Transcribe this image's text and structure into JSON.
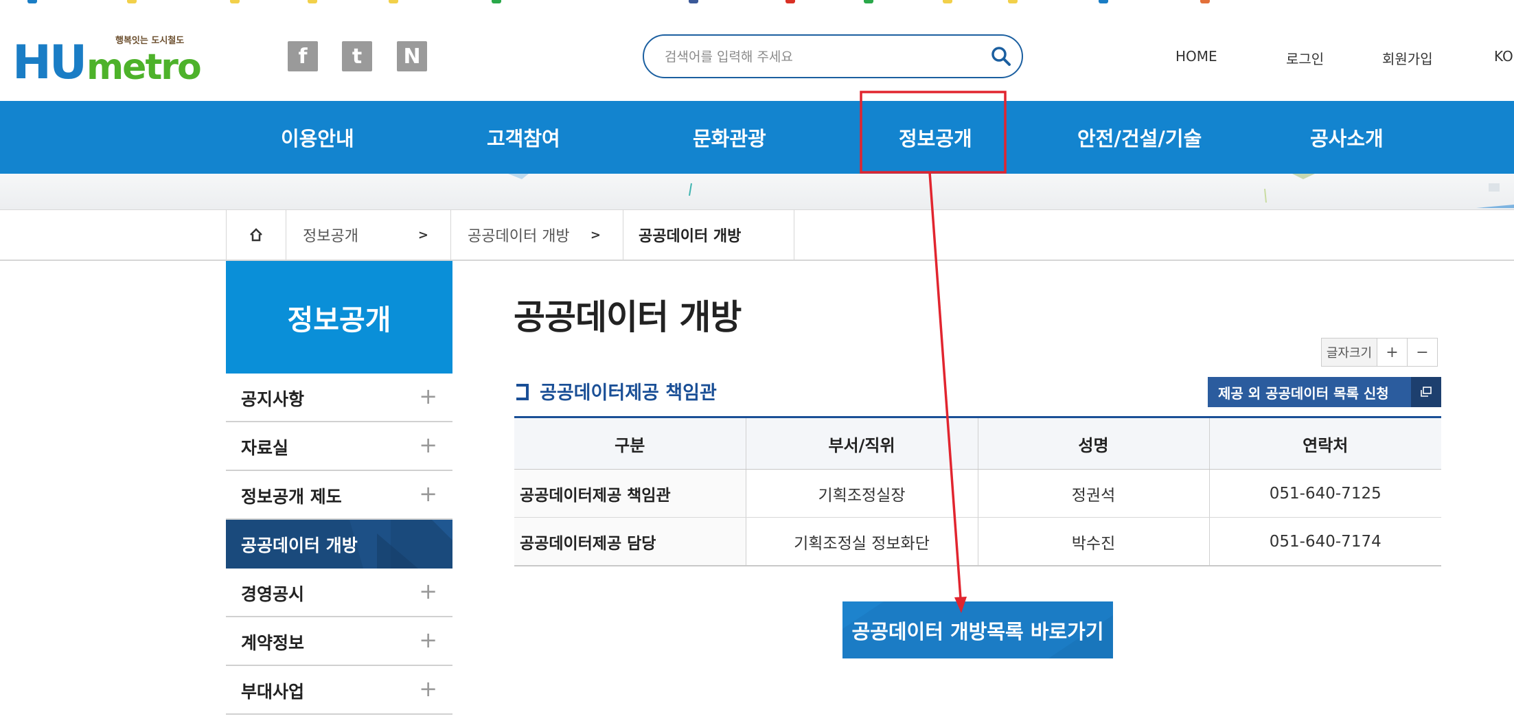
{
  "colors": {
    "brand_blue": "#1384cf",
    "navy": "#1a4a7c",
    "title_blue": "#1a4f96",
    "logo_green": "#4db22a",
    "annotation_red": "#e1252f"
  },
  "logo": {
    "hu": "HU",
    "metro": "metro",
    "tagline": "행복잇는 도시철도"
  },
  "social": [
    {
      "name": "facebook",
      "glyph": "f"
    },
    {
      "name": "twitter",
      "glyph": "t"
    },
    {
      "name": "naver",
      "glyph": "N"
    }
  ],
  "search": {
    "placeholder": "검색어를 입력해 주세요",
    "icon": "search-icon"
  },
  "utility": {
    "home": "HOME",
    "login": "로그인",
    "join": "회원가입",
    "lang": "KO"
  },
  "gnb": [
    "이용안내",
    "고객참여",
    "문화관광",
    "정보공개",
    "안전/건설/기술",
    "공사소개"
  ],
  "breadcrumb": {
    "home_icon": "home-icon",
    "level1": "정보공개",
    "level2": "공공데이터 개방",
    "level3": "공공데이터 개방",
    "arrow": ">"
  },
  "lnb": {
    "title": "정보공개",
    "plus": "+",
    "items": [
      "공지사항",
      "자료실",
      "정보공개 제도",
      "공공데이터 개방",
      "경영공시",
      "계약정보",
      "부대사업"
    ],
    "active_index": 3
  },
  "page": {
    "title": "공공데이터 개방",
    "fontsize": {
      "label": "글자크기",
      "plus": "+",
      "minus": "−"
    },
    "section_title": "공공데이터제공 책임관",
    "request_button": "제공 외 공공데이터 목록 신청",
    "request_icon": "new-window-icon",
    "go_button": "공공데이터 개방목록 바로가기"
  },
  "table": {
    "headers": [
      "구분",
      "부서/직위",
      "성명",
      "연락처"
    ],
    "rows": [
      [
        "공공데이터제공 책임관",
        "기획조정실장",
        "정권석",
        "051-640-7125"
      ],
      [
        "공공데이터제공 담당",
        "기획조정실 정보화단",
        "박수진",
        "051-640-7174"
      ]
    ]
  }
}
